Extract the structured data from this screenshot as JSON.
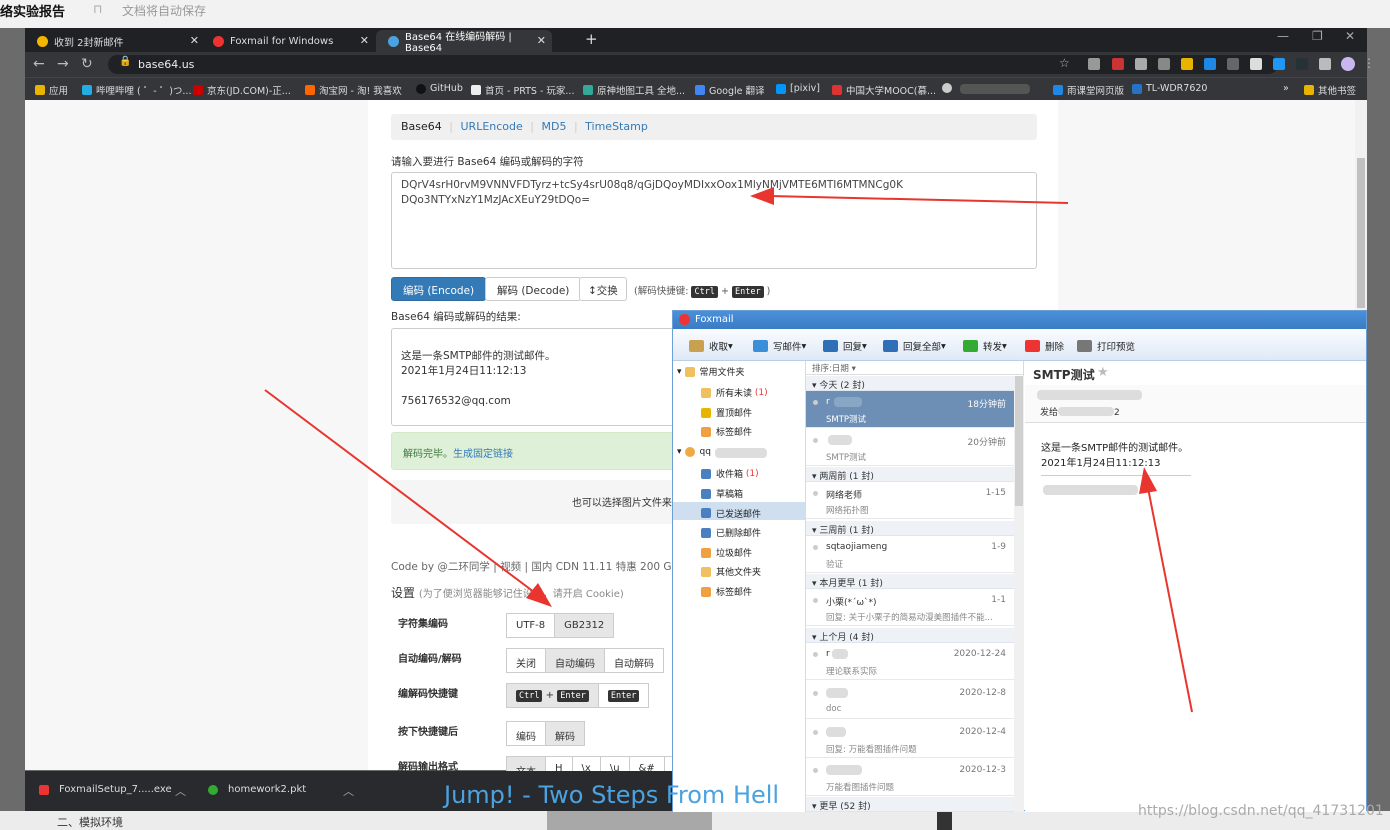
{
  "doc": {
    "title": "络实验报告",
    "bookmark_icon": "bookmark-outline-icon",
    "autosave": "文档将自动保存"
  },
  "browser": {
    "tabs": [
      {
        "label": "收到 2封新邮件",
        "icon": "chrome-icon",
        "color": "#f2b600"
      },
      {
        "label": "Foxmail for Windows",
        "icon": "foxmail-icon",
        "color": "#e33"
      },
      {
        "label": "Base64 在线编码解码 | Base64 ",
        "icon": "globe-icon",
        "color": "#4aa3e0"
      }
    ],
    "url": "base64.us",
    "bookmarks": [
      "应用",
      "哔哩哔哩 ( ゜- ゜)つ...",
      "京东(JD.COM)-正...",
      "淘宝网 - 淘! 我喜欢",
      "GitHub",
      "首页 - PRTS - 玩家...",
      "原神地图工具 全地...",
      "Google 翻译",
      "[pixiv]",
      "中国大学MOOC(慕...",
      "雨课堂网页版",
      "TL-WDR7620"
    ],
    "bookmarks_more": "»",
    "other_bookmarks": "其他书签"
  },
  "base64": {
    "subnav": [
      "Base64",
      "URLEncode",
      "MD5",
      "TimeStamp"
    ],
    "prompt": "请输入要进行 Base64 编码或解码的字符",
    "input_value": "DQrV4srH0rvM9VNNVFDTyrz+tcSy4srU08q8/qGjDQoyMDIxxOox1MlyNMjVMTE6MTI6MTMNCg0K\nDQo3NTYxNzY1MzJAcXEuY29tDQo=",
    "encode_label": "编码 (Encode)",
    "decode_label": "解码 (Decode)",
    "swap_label": "↕交换",
    "hint_prefix": "(解码快捷键:",
    "hint_key1": "Ctrl",
    "hint_plus": "+",
    "hint_key2": "Enter",
    "hint_suffix": ")",
    "result_label": "Base64 编码或解码的结果:",
    "output_lines": [
      "这是一条SMTP邮件的测试邮件。",
      "2021年1月24日11:12:13",
      "",
      "756176532@qq.com"
    ],
    "alert_text": "解码完毕。",
    "alert_link": "生成固定链接",
    "datauri_text": "也可以选择图片文件来获取它的 Base64 编码的 DataURI 形式:",
    "codeby": "Code by @二环同学 | 视频 | 国内 CDN 11.11 特惠 200 GB 流量",
    "settings_title": "设置",
    "settings_note": "(为了便浏览器能够记住设置，请开启 Cookie)",
    "settings": [
      {
        "label": "字符集编码",
        "options": [
          "UTF-8",
          "GB2312"
        ],
        "selected": 1
      },
      {
        "label": "自动编码/解码",
        "options": [
          "关闭",
          "自动编码",
          "自动解码"
        ],
        "selected": 1
      },
      {
        "label": "编解码快捷键",
        "options": [
          "Ctrl + Enter",
          "Enter"
        ],
        "selected": 0
      },
      {
        "label": "按下快捷键后",
        "options": [
          "编码",
          "解码"
        ],
        "selected": 1
      },
      {
        "label": "解码输出格式",
        "options": [
          "文本",
          "H",
          "\\x",
          "\\u",
          "&#",
          "{"
        ],
        "selected": 0
      }
    ]
  },
  "downloads": [
    {
      "name": "FoxmailSetup_7.....exe",
      "icon": "foxmail-icon"
    },
    {
      "name": "homework2.pkt",
      "icon": "packet-tracer-icon"
    }
  ],
  "below_text": "二、模拟环境",
  "overlay_text": "Jump! - Two Steps From Hell",
  "watermark": "https://blog.csdn.net/qq_41731201",
  "foxmail": {
    "title": "Foxmail",
    "toolbar": [
      "收取",
      "写邮件",
      "回复",
      "回复全部",
      "转发",
      "删除",
      "打印预览"
    ],
    "nav": [
      {
        "label": "常用文件夹",
        "type": "header"
      },
      {
        "label": "所有未读",
        "count": "(1)"
      },
      {
        "label": "置顶邮件"
      },
      {
        "label": "标签邮件"
      },
      {
        "label": "qq",
        "type": "account"
      },
      {
        "label": "收件箱",
        "count": "(1)"
      },
      {
        "label": "草稿箱"
      },
      {
        "label": "已发送邮件",
        "selected": true
      },
      {
        "label": "已删除邮件"
      },
      {
        "label": "垃圾邮件"
      },
      {
        "label": "其他文件夹"
      },
      {
        "label": "标签邮件"
      }
    ],
    "sort_label": "排序:日期 ▾",
    "groups": [
      {
        "label": "今天 (2 封)",
        "mails": [
          {
            "sender": "r",
            "date": "18分钟前",
            "subject": "SMTP测试",
            "selected": true
          },
          {
            "sender": "",
            "date": "20分钟前",
            "subject": "SMTP测试"
          }
        ]
      },
      {
        "label": "两周前 (1 封)",
        "mails": [
          {
            "sender": "网络老师",
            "date": "1-15",
            "subject": "网络拓扑图"
          }
        ]
      },
      {
        "label": "三周前 (1 封)",
        "mails": [
          {
            "sender": "sqtaojiameng",
            "date": "1-9",
            "subject": "验证"
          }
        ]
      },
      {
        "label": "本月更早 (1 封)",
        "mails": [
          {
            "sender": "小栗(*´ω`*)",
            "date": "1-1",
            "subject": "回复: 关于小栗子的简易动漫美图插件不能..."
          }
        ]
      },
      {
        "label": "上个月 (4 封)",
        "mails": [
          {
            "sender": "r",
            "date": "2020-12-24",
            "subject": "理论联系实际"
          },
          {
            "sender": "",
            "date": "2020-12-8",
            "subject": "doc"
          },
          {
            "sender": "",
            "date": "2020-12-4",
            "subject": "回复: 万能看图插件问题"
          },
          {
            "sender": "",
            "date": "2020-12-3",
            "subject": "万能看图插件问题"
          }
        ]
      },
      {
        "label": "更早 (52 封)",
        "mails": []
      }
    ],
    "read": {
      "subject": "SMTP测试",
      "to_label": "发给",
      "to_value": "2",
      "body": [
        "这是一条SMTP邮件的测试邮件。",
        "2021年1月24日11:12:13"
      ]
    }
  },
  "colors": {
    "accent": "#337ab7",
    "success_bg": "#dff0d8",
    "annotation_arrow": "#e8352e"
  }
}
